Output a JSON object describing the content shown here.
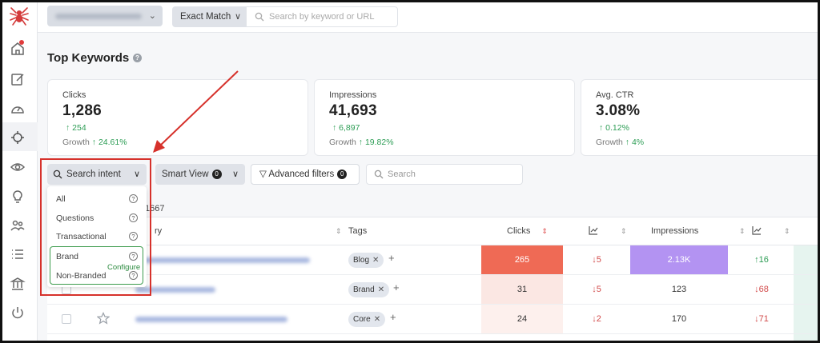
{
  "topbar": {
    "match_select": "Exact Match",
    "search_placeholder": "Search by keyword or URL"
  },
  "page": {
    "title": "Top Keywords",
    "help": "?"
  },
  "cards": [
    {
      "label": "Clicks",
      "value": "1,286",
      "delta": "254",
      "growth_label": "Growth",
      "growth": "24.61%"
    },
    {
      "label": "Impressions",
      "value": "41,693",
      "delta": "6,897",
      "growth_label": "Growth",
      "growth": "19.82%"
    },
    {
      "label": "Avg. CTR",
      "value": "3.08%",
      "delta": "0.12%",
      "growth_label": "Growth",
      "growth": "4%"
    }
  ],
  "filters": {
    "search_intent": "Search intent",
    "smart_view": "Smart View",
    "smart_view_count": "0",
    "advanced_filters": "Advanced filters",
    "advanced_filters_count": "0",
    "search_placeholder": "Search"
  },
  "count_text": "1667",
  "table": {
    "headers": {
      "query": "ry",
      "tags": "Tags",
      "clicks": "Clicks",
      "impressions": "Impressions"
    },
    "rows": [
      {
        "tag": "Blog",
        "clicks": "265",
        "clicks_change": "↓5",
        "impressions": "2.13K",
        "impressions_change": "↑16"
      },
      {
        "tag": "Brand",
        "clicks": "31",
        "clicks_change": "↓5",
        "impressions": "123",
        "impressions_change": "↓68"
      },
      {
        "tag": "Core",
        "clicks": "24",
        "clicks_change": "↓2",
        "impressions": "170",
        "impressions_change": "↓71"
      }
    ]
  },
  "dropdown": {
    "items": [
      "All",
      "Questions",
      "Transactional",
      "Brand",
      "Non-Branded"
    ],
    "configure": "Configure"
  },
  "colors": {
    "accent_red": "#d6312b",
    "positive_green": "#2d9d55",
    "clicks_high": "#ef6a55",
    "impressions_high": "#b393f2",
    "configure_green": "#3d9c4d"
  }
}
